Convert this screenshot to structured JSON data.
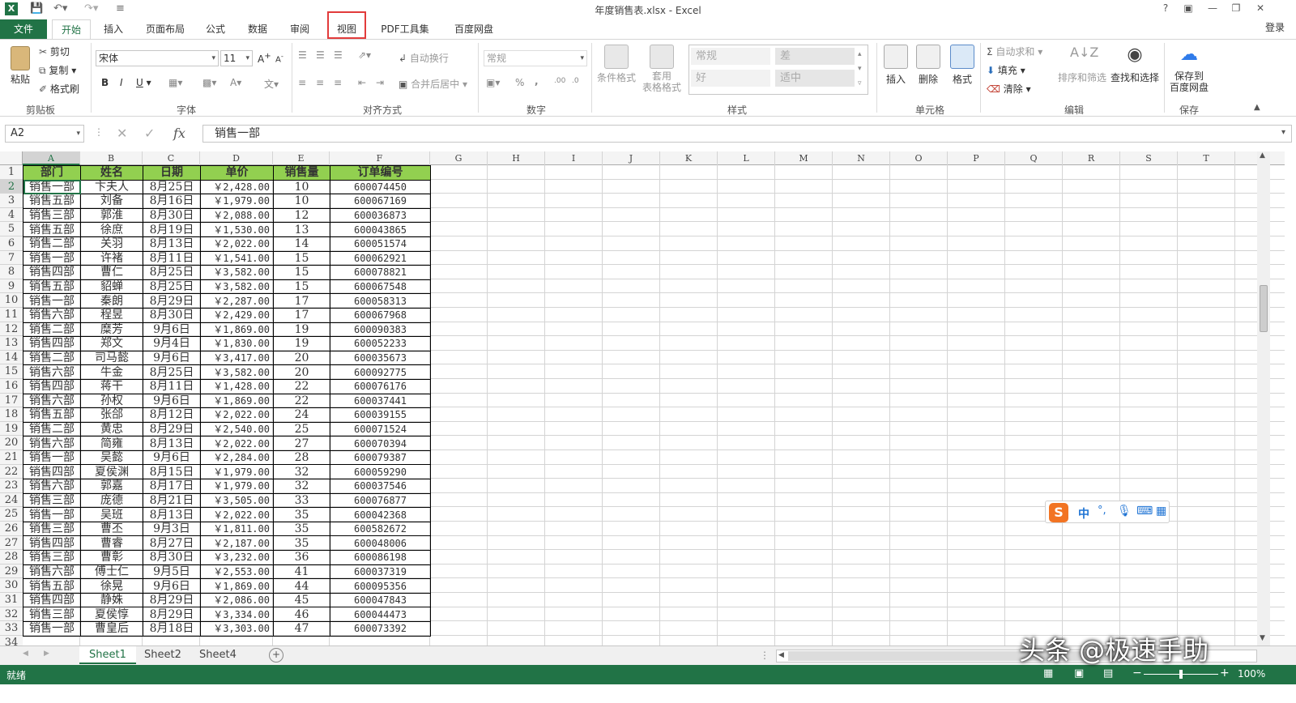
{
  "window": {
    "title": "年度销售表.xlsx - Excel",
    "help": "?",
    "login": "登录"
  },
  "tabs": [
    "文件",
    "开始",
    "插入",
    "页面布局",
    "公式",
    "数据",
    "审阅",
    "视图",
    "PDF工具集",
    "百度网盘"
  ],
  "ribbon": {
    "clipboard": {
      "paste": "粘贴",
      "cut": "剪切",
      "copy": "复制",
      "format_painter": "格式刷",
      "label": "剪贴板"
    },
    "font": {
      "name": "宋体",
      "size": "11",
      "label": "字体",
      "bold": "B",
      "italic": "I",
      "underline": "U"
    },
    "alignment": {
      "wrap": "自动换行",
      "merge": "合并后居中",
      "label": "对齐方式"
    },
    "number": {
      "format": "常规",
      "label": "数字",
      "percent": "%",
      "comma": ","
    },
    "styles": {
      "conditional": "条件格式",
      "table": "套用\n表格格式",
      "normal": "常规",
      "bad": "差",
      "good": "好",
      "neutral": "适中",
      "label": "样式"
    },
    "cells": {
      "insert": "插入",
      "delete": "删除",
      "format": "格式",
      "label": "单元格"
    },
    "editing": {
      "autosum": "自动求和",
      "fill": "填充",
      "clear": "清除",
      "sort": "排序和筛选",
      "find": "查找和选择",
      "label": "编辑"
    },
    "save": {
      "save": "保存到\n百度网盘",
      "label": "保存"
    }
  },
  "formula_bar": {
    "name_box": "A2",
    "value": "销售一部",
    "fx": "fx"
  },
  "columns": [
    "A",
    "B",
    "C",
    "D",
    "E",
    "F",
    "G",
    "H",
    "I",
    "J",
    "K",
    "L",
    "M",
    "N",
    "O",
    "P",
    "Q",
    "R",
    "S",
    "T"
  ],
  "sheet": {
    "headers": [
      "部门",
      "姓名",
      "日期",
      "单价",
      "销售量",
      "订单编号"
    ],
    "rows": [
      [
        "销售一部",
        "卞夫人",
        "8月25日",
        "￥2,428.00",
        "10",
        "600074450"
      ],
      [
        "销售五部",
        "刘备",
        "8月16日",
        "￥1,979.00",
        "10",
        "600067169"
      ],
      [
        "销售三部",
        "郭淮",
        "8月30日",
        "￥2,088.00",
        "12",
        "600036873"
      ],
      [
        "销售五部",
        "徐庶",
        "8月19日",
        "￥1,530.00",
        "13",
        "600043865"
      ],
      [
        "销售二部",
        "关羽",
        "8月13日",
        "￥2,022.00",
        "14",
        "600051574"
      ],
      [
        "销售一部",
        "许褚",
        "8月11日",
        "￥1,541.00",
        "15",
        "600062921"
      ],
      [
        "销售四部",
        "曹仁",
        "8月25日",
        "￥3,582.00",
        "15",
        "600078821"
      ],
      [
        "销售五部",
        "貂蝉",
        "8月25日",
        "￥3,582.00",
        "15",
        "600067548"
      ],
      [
        "销售一部",
        "秦朗",
        "8月29日",
        "￥2,287.00",
        "17",
        "600058313"
      ],
      [
        "销售六部",
        "程昱",
        "8月30日",
        "￥2,429.00",
        "17",
        "600067968"
      ],
      [
        "销售二部",
        "糜芳",
        "9月6日",
        "￥1,869.00",
        "19",
        "600090383"
      ],
      [
        "销售四部",
        "郑文",
        "9月4日",
        "￥1,830.00",
        "19",
        "600052233"
      ],
      [
        "销售二部",
        "司马懿",
        "9月6日",
        "￥3,417.00",
        "20",
        "600035673"
      ],
      [
        "销售六部",
        "牛金",
        "8月25日",
        "￥3,582.00",
        "20",
        "600092775"
      ],
      [
        "销售四部",
        "蒋干",
        "8月11日",
        "￥1,428.00",
        "22",
        "600076176"
      ],
      [
        "销售六部",
        "孙权",
        "9月6日",
        "￥1,869.00",
        "22",
        "600037441"
      ],
      [
        "销售五部",
        "张郃",
        "8月12日",
        "￥2,022.00",
        "24",
        "600039155"
      ],
      [
        "销售二部",
        "黄忠",
        "8月29日",
        "￥2,540.00",
        "25",
        "600071524"
      ],
      [
        "销售六部",
        "简雍",
        "8月13日",
        "￥2,022.00",
        "27",
        "600070394"
      ],
      [
        "销售一部",
        "吴懿",
        "9月6日",
        "￥2,284.00",
        "28",
        "600079387"
      ],
      [
        "销售四部",
        "夏侯渊",
        "8月15日",
        "￥1,979.00",
        "32",
        "600059290"
      ],
      [
        "销售六部",
        "郭嘉",
        "8月17日",
        "￥1,979.00",
        "32",
        "600037546"
      ],
      [
        "销售三部",
        "庞德",
        "8月21日",
        "￥3,505.00",
        "33",
        "600076877"
      ],
      [
        "销售一部",
        "吴班",
        "8月13日",
        "￥2,022.00",
        "35",
        "600042368"
      ],
      [
        "销售三部",
        "曹丕",
        "9月3日",
        "￥1,811.00",
        "35",
        "600582672"
      ],
      [
        "销售四部",
        "曹睿",
        "8月27日",
        "￥2,187.00",
        "35",
        "600048006"
      ],
      [
        "销售三部",
        "曹彰",
        "8月30日",
        "￥3,232.00",
        "36",
        "600086198"
      ],
      [
        "销售六部",
        "傅士仁",
        "9月5日",
        "￥2,553.00",
        "41",
        "600037319"
      ],
      [
        "销售五部",
        "徐晃",
        "9月6日",
        "￥1,869.00",
        "44",
        "600095356"
      ],
      [
        "销售四部",
        "静姝",
        "8月29日",
        "￥2,086.00",
        "45",
        "600047843"
      ],
      [
        "销售三部",
        "夏侯惇",
        "8月29日",
        "￥3,334.00",
        "46",
        "600044473"
      ],
      [
        "销售一部",
        "曹皇后",
        "8月18日",
        "￥3,303.00",
        "47",
        "600073392"
      ]
    ]
  },
  "sheet_tabs": [
    "Sheet1",
    "Sheet2",
    "Sheet4"
  ],
  "status": {
    "ready": "就绪",
    "zoom": "100%"
  },
  "ime": {
    "lang": "中"
  },
  "watermark": "头条 @极速手助",
  "colors": {
    "excel_green": "#217346",
    "header_fill": "#92d050",
    "highlight": "#e23b3b"
  }
}
